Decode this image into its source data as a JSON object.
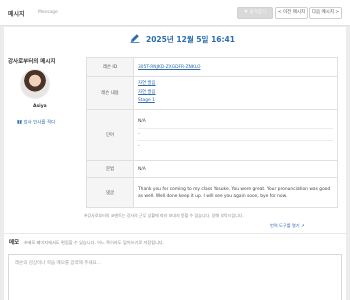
{
  "header": {
    "title": "메시지",
    "subtitle": "Message",
    "favorite_label": "♥ 즐겨찾기",
    "prev_label": "< 이전 메시지",
    "next_label": "다음 메시지 >"
  },
  "date": "2025년 12월 5일 16:41",
  "tutor": {
    "section_label": "강사로부터의 메시지",
    "name": "Asiya",
    "profile_link": "강사 인사를 적다"
  },
  "table": {
    "lesson_id_label": "레슨 ID",
    "lesson_id": "305T-RNJKD-ZXGDFR-ZNKLO",
    "lesson_content_label": "레슨 내용",
    "lesson_content": [
      "자연 발음",
      "자연 발음",
      "Stage 1"
    ],
    "word_label": "단어",
    "words": [
      "N/A",
      "-",
      "-"
    ],
    "grammar_label": "문법",
    "grammar": "N/A",
    "comment_label": "댓글",
    "comment": "Thank you for coming to my class Yosuke. You were great. Your pronunciation was good as well. Well done keep it up. I will see you again soon, bye for now."
  },
  "note": "※강사로부터의 코멘트는 강사의 근무 상황에 따라 보내지 못할 수 있습니다. 양해 부탁드립니다.",
  "report_link": "번역 도구를 열기",
  "memo": {
    "title": "메모",
    "description": "※메모 페이지에서도 편집할 수 있습니다. 어느 쪽이라도 덮어쓰기로 저장됩니다.",
    "placeholder": "레슨의 감상이나 학습 메모를 입력해 주세요..."
  },
  "colors": {
    "accent": "#2b6cb0",
    "background": "#ececec"
  }
}
